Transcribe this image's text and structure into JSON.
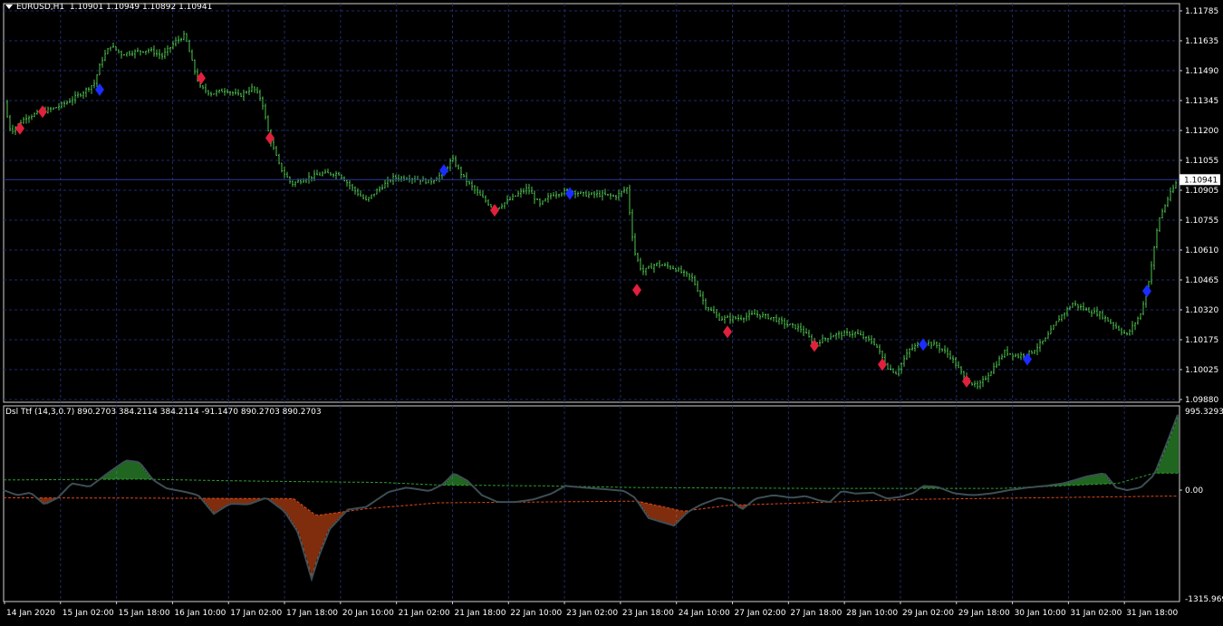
{
  "main_window": {
    "symbol": "EURUSD,H1",
    "ohlc": "1.10901 1.10949 1.10892 1.10941",
    "current_price": "1.10941",
    "price_ticks": [
      "1.11785",
      "1.11635",
      "1.11490",
      "1.11345",
      "1.11200",
      "1.11055",
      "1.10905",
      "1.10755",
      "1.10610",
      "1.10465",
      "1.10320",
      "1.10175",
      "1.10025",
      "1.09880"
    ]
  },
  "sub_window": {
    "indicator": "Dsl Ttf (14,3,0.7) 890.2703 384.2114 384.2114 -91.1470 890.2703 890.2703",
    "ticks": [
      "995.3293",
      "0.00",
      "-1315.969"
    ]
  },
  "time_axis": {
    "labels": [
      "14 Jan 2020",
      "15 Jan 02:00",
      "15 Jan 18:00",
      "16 Jan 10:00",
      "17 Jan 02:00",
      "17 Jan 18:00",
      "20 Jan 10:00",
      "21 Jan 02:00",
      "21 Jan 18:00",
      "22 Jan 10:00",
      "23 Jan 02:00",
      "23 Jan 18:00",
      "24 Jan 10:00",
      "27 Jan 02:00",
      "27 Jan 18:00",
      "28 Jan 10:00",
      "29 Jan 02:00",
      "29 Jan 18:00",
      "30 Jan 10:00",
      "31 Jan 02:00",
      "31 Jan 18:00"
    ]
  },
  "colors": {
    "background": "#000000",
    "grid": "#1e2a6e",
    "bars": "#4cc24c",
    "marker_sell": "#e0203c",
    "marker_buy": "#1a2cff",
    "hist_up": "#3fcc3f",
    "hist_down": "#ff5a1a",
    "signal_line": "#3d4f55",
    "level_up": "#2e9e2e",
    "level_down": "#e0481a",
    "frame": "#cfcfcf"
  },
  "chart_data": [
    {
      "type": "candlestick",
      "ylim": [
        1.0988,
        1.1178
      ],
      "close_path": [
        [
          0,
          1.1131
        ],
        [
          8,
          1.1117
        ],
        [
          15,
          1.112
        ],
        [
          25,
          1.1124
        ],
        [
          40,
          1.1126
        ],
        [
          55,
          1.1128
        ],
        [
          70,
          1.1131
        ],
        [
          85,
          1.1135
        ],
        [
          100,
          1.114
        ],
        [
          108,
          1.1151
        ],
        [
          118,
          1.1158
        ],
        [
          130,
          1.1154
        ],
        [
          145,
          1.1155
        ],
        [
          160,
          1.1156
        ],
        [
          175,
          1.1153
        ],
        [
          190,
          1.116
        ],
        [
          200,
          1.1163
        ],
        [
          210,
          1.1147
        ],
        [
          217,
          1.1138
        ],
        [
          230,
          1.1135
        ],
        [
          245,
          1.1137
        ],
        [
          260,
          1.1134
        ],
        [
          275,
          1.1138
        ],
        [
          285,
          1.1132
        ],
        [
          293,
          1.1115
        ],
        [
          305,
          1.11
        ],
        [
          318,
          1.1092
        ],
        [
          335,
          1.1095
        ],
        [
          352,
          1.1097
        ],
        [
          370,
          1.1097
        ],
        [
          385,
          1.109
        ],
        [
          400,
          1.1084
        ],
        [
          415,
          1.109
        ],
        [
          430,
          1.1095
        ],
        [
          450,
          1.1095
        ],
        [
          470,
          1.1093
        ],
        [
          485,
          1.1097
        ],
        [
          495,
          1.1104
        ],
        [
          508,
          1.1095
        ],
        [
          522,
          1.1088
        ],
        [
          542,
          1.108
        ],
        [
          560,
          1.1085
        ],
        [
          578,
          1.109
        ],
        [
          592,
          1.1082
        ],
        [
          605,
          1.1087
        ],
        [
          625,
          1.1089
        ],
        [
          640,
          1.1087
        ],
        [
          660,
          1.1087
        ],
        [
          675,
          1.1086
        ],
        [
          688,
          1.109
        ],
        [
          696,
          1.106
        ],
        [
          705,
          1.105
        ],
        [
          720,
          1.1054
        ],
        [
          740,
          1.1052
        ],
        [
          760,
          1.1047
        ],
        [
          775,
          1.1034
        ],
        [
          790,
          1.1028
        ],
        [
          810,
          1.1028
        ],
        [
          830,
          1.103
        ],
        [
          850,
          1.1028
        ],
        [
          865,
          1.1025
        ],
        [
          880,
          1.1023
        ],
        [
          895,
          1.1016
        ],
        [
          915,
          1.102
        ],
        [
          940,
          1.1021
        ],
        [
          962,
          1.1016
        ],
        [
          975,
          1.1005
        ],
        [
          985,
          1.1002
        ],
        [
          1000,
          1.1013
        ],
        [
          1015,
          1.1017
        ],
        [
          1030,
          1.1015
        ],
        [
          1045,
          1.101
        ],
        [
          1060,
          1.1
        ],
        [
          1075,
          1.0995
        ],
        [
          1090,
          1.1003
        ],
        [
          1105,
          1.1012
        ],
        [
          1120,
          1.101
        ],
        [
          1135,
          1.1012
        ],
        [
          1150,
          1.1018
        ],
        [
          1165,
          1.1028
        ],
        [
          1180,
          1.1035
        ],
        [
          1195,
          1.1032
        ],
        [
          1210,
          1.103
        ],
        [
          1225,
          1.1025
        ],
        [
          1240,
          1.102
        ],
        [
          1255,
          1.103
        ],
        [
          1265,
          1.1048
        ],
        [
          1275,
          1.1075
        ],
        [
          1285,
          1.1085
        ],
        [
          1296,
          1.1094
        ]
      ],
      "markers": [
        {
          "t": 18,
          "price": 1.11185,
          "side": "sell"
        },
        {
          "t": 43,
          "price": 1.11265,
          "side": "sell"
        },
        {
          "t": 106,
          "price": 1.1137,
          "side": "buy"
        },
        {
          "t": 218,
          "price": 1.11425,
          "side": "sell"
        },
        {
          "t": 294,
          "price": 1.1114,
          "side": "sell"
        },
        {
          "t": 486,
          "price": 1.10985,
          "side": "buy"
        },
        {
          "t": 542,
          "price": 1.10795,
          "side": "sell"
        },
        {
          "t": 625,
          "price": 1.10875,
          "side": "buy"
        },
        {
          "t": 699,
          "price": 1.10415,
          "side": "sell"
        },
        {
          "t": 799,
          "price": 1.10215,
          "side": "sell"
        },
        {
          "t": 895,
          "price": 1.1015,
          "side": "sell"
        },
        {
          "t": 970,
          "price": 1.1006,
          "side": "sell"
        },
        {
          "t": 1015,
          "price": 1.10155,
          "side": "buy"
        },
        {
          "t": 1063,
          "price": 1.0998,
          "side": "sell"
        },
        {
          "t": 1130,
          "price": 1.10085,
          "side": "buy"
        },
        {
          "t": 1262,
          "price": 1.1041,
          "side": "buy"
        }
      ]
    },
    {
      "type": "histogram",
      "ylim": [
        -1315.969,
        995.3293
      ],
      "value_path": [
        [
          0,
          0
        ],
        [
          15,
          -60
        ],
        [
          30,
          -30
        ],
        [
          45,
          -170
        ],
        [
          60,
          -90
        ],
        [
          75,
          80
        ],
        [
          95,
          40
        ],
        [
          115,
          200
        ],
        [
          135,
          350
        ],
        [
          150,
          330
        ],
        [
          165,
          120
        ],
        [
          180,
          20
        ],
        [
          200,
          -20
        ],
        [
          215,
          -60
        ],
        [
          232,
          -280
        ],
        [
          250,
          -160
        ],
        [
          270,
          -170
        ],
        [
          290,
          -90
        ],
        [
          310,
          -250
        ],
        [
          325,
          -500
        ],
        [
          340,
          -1050
        ],
        [
          348,
          -780
        ],
        [
          360,
          -460
        ],
        [
          380,
          -230
        ],
        [
          400,
          -200
        ],
        [
          425,
          -20
        ],
        [
          445,
          30
        ],
        [
          470,
          -10
        ],
        [
          485,
          70
        ],
        [
          497,
          200
        ],
        [
          512,
          110
        ],
        [
          528,
          -60
        ],
        [
          545,
          -140
        ],
        [
          565,
          -140
        ],
        [
          585,
          -110
        ],
        [
          605,
          -40
        ],
        [
          620,
          50
        ],
        [
          640,
          30
        ],
        [
          665,
          10
        ],
        [
          685,
          -10
        ],
        [
          697,
          -90
        ],
        [
          712,
          -330
        ],
        [
          740,
          -420
        ],
        [
          755,
          -260
        ],
        [
          770,
          -170
        ],
        [
          790,
          -90
        ],
        [
          805,
          -130
        ],
        [
          815,
          -230
        ],
        [
          830,
          -100
        ],
        [
          850,
          -60
        ],
        [
          870,
          -90
        ],
        [
          885,
          -70
        ],
        [
          900,
          -120
        ],
        [
          912,
          -140
        ],
        [
          925,
          -10
        ],
        [
          940,
          -40
        ],
        [
          960,
          -30
        ],
        [
          975,
          -100
        ],
        [
          990,
          -80
        ],
        [
          1005,
          -30
        ],
        [
          1015,
          50
        ],
        [
          1030,
          40
        ],
        [
          1050,
          -40
        ],
        [
          1070,
          -60
        ],
        [
          1090,
          -40
        ],
        [
          1110,
          0
        ],
        [
          1130,
          30
        ],
        [
          1150,
          50
        ],
        [
          1170,
          80
        ],
        [
          1195,
          160
        ],
        [
          1215,
          200
        ],
        [
          1228,
          30
        ],
        [
          1240,
          0
        ],
        [
          1255,
          30
        ],
        [
          1270,
          180
        ],
        [
          1285,
          580
        ],
        [
          1296,
          890
        ]
      ],
      "level_up_path": [
        [
          0,
          120
        ],
        [
          150,
          130
        ],
        [
          250,
          110
        ],
        [
          420,
          90
        ],
        [
          480,
          60
        ],
        [
          600,
          50
        ],
        [
          700,
          30
        ],
        [
          900,
          20
        ],
        [
          1100,
          20
        ],
        [
          1230,
          80
        ],
        [
          1270,
          200
        ]
      ],
      "level_down_path": [
        [
          0,
          -90
        ],
        [
          320,
          -100
        ],
        [
          345,
          -300
        ],
        [
          400,
          -220
        ],
        [
          480,
          -150
        ],
        [
          700,
          -130
        ],
        [
          750,
          -250
        ],
        [
          800,
          -180
        ],
        [
          1000,
          -110
        ],
        [
          1290,
          -70
        ]
      ]
    }
  ]
}
